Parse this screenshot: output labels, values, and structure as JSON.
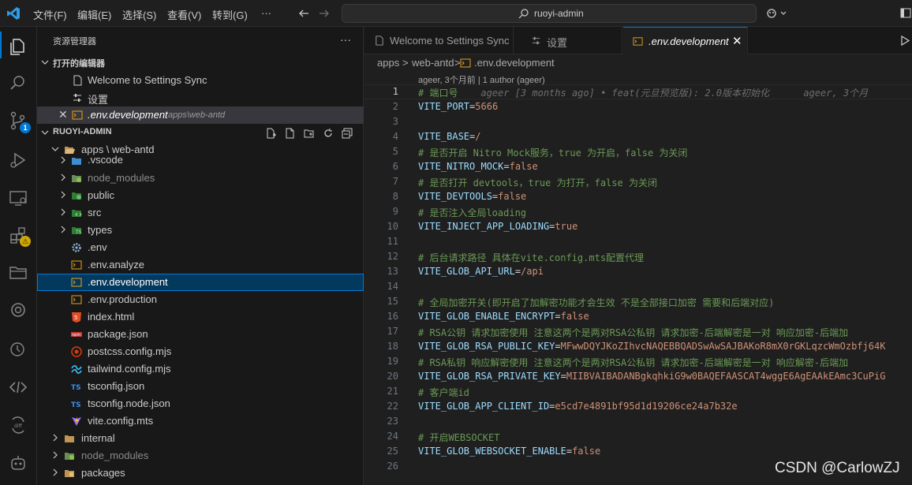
{
  "menu": [
    "文件(F)",
    "编辑(E)",
    "选择(S)",
    "查看(V)",
    "转到(G)",
    "···"
  ],
  "command_center": {
    "label": "ruoyi-admin"
  },
  "activity_badges": {
    "scm": "1",
    "extensions": "⚠"
  },
  "sidebar": {
    "title": "资源管理器",
    "open_editors_header": "打开的编辑器",
    "open_editors": [
      {
        "name": "Welcome to Settings Sync",
        "path": ""
      },
      {
        "name": "设置",
        "path": ""
      },
      {
        "name": ".env.development",
        "path": "apps\\web-antd"
      }
    ],
    "workspace_header": "RUOYI-ADMIN",
    "tree": [
      {
        "name": "apps \\ web-antd",
        "kind": "folder-open",
        "depth": 1
      },
      {
        "name": ".vscode",
        "kind": "folder",
        "depth": 2
      },
      {
        "name": "node_modules",
        "kind": "folder",
        "depth": 2,
        "dim": true
      },
      {
        "name": "public",
        "kind": "folder",
        "depth": 2
      },
      {
        "name": "src",
        "kind": "folder",
        "depth": 2
      },
      {
        "name": "types",
        "kind": "folder",
        "depth": 2
      },
      {
        "name": ".env",
        "kind": "gear",
        "depth": 2
      },
      {
        "name": ".env.analyze",
        "kind": "env",
        "depth": 2
      },
      {
        "name": ".env.development",
        "kind": "env",
        "depth": 2,
        "selected": true
      },
      {
        "name": ".env.production",
        "kind": "env",
        "depth": 2
      },
      {
        "name": "index.html",
        "kind": "html",
        "depth": 2
      },
      {
        "name": "package.json",
        "kind": "npm",
        "depth": 2
      },
      {
        "name": "postcss.config.mjs",
        "kind": "postcss",
        "depth": 2
      },
      {
        "name": "tailwind.config.mjs",
        "kind": "tailwind",
        "depth": 2
      },
      {
        "name": "tsconfig.json",
        "kind": "ts",
        "depth": 2
      },
      {
        "name": "tsconfig.node.json",
        "kind": "ts",
        "depth": 2
      },
      {
        "name": "vite.config.mts",
        "kind": "vite",
        "depth": 2
      },
      {
        "name": "internal",
        "kind": "folder",
        "depth": 1
      },
      {
        "name": "node_modules",
        "kind": "folder",
        "depth": 1,
        "dim": true
      },
      {
        "name": "packages",
        "kind": "folder",
        "depth": 1
      }
    ]
  },
  "tabs": [
    {
      "label": "Welcome to Settings Sync"
    },
    {
      "label": "设置"
    },
    {
      "label": ".env.development",
      "active": true
    }
  ],
  "breadcrumbs": [
    "apps",
    ">",
    "web-antd",
    ">",
    ".env.development"
  ],
  "blame": "ageer, 3个月前 | 1 author (ageer)",
  "ghost_blame": "ageer [3 months ago] • feat(元旦预览版): 2.0版本初始化      ageer, 3个月",
  "code": [
    {
      "n": "1",
      "c": "# 端口号"
    },
    {
      "n": "2",
      "k": "VITE_PORT",
      "v": "5666"
    },
    {
      "n": "3"
    },
    {
      "n": "4",
      "k": "VITE_BASE",
      "v": "/"
    },
    {
      "n": "5",
      "c": "# 是否开启 Nitro Mock服务，true 为开启，false 为关闭"
    },
    {
      "n": "6",
      "k": "VITE_NITRO_MOCK",
      "v": "false"
    },
    {
      "n": "7",
      "c": "# 是否打开 devtools，true 为打开，false 为关闭"
    },
    {
      "n": "8",
      "k": "VITE_DEVTOOLS",
      "v": "false"
    },
    {
      "n": "9",
      "c": "# 是否注入全局loading"
    },
    {
      "n": "10",
      "k": "VITE_INJECT_APP_LOADING",
      "v": "true"
    },
    {
      "n": "11"
    },
    {
      "n": "12",
      "c": "# 后台请求路径 具体在vite.config.mts配置代理"
    },
    {
      "n": "13",
      "k": "VITE_GLOB_API_URL",
      "v": "/api"
    },
    {
      "n": "14"
    },
    {
      "n": "15",
      "c": "# 全局加密开关(即开启了加解密功能才会生效 不是全部接口加密 需要和后端对应)"
    },
    {
      "n": "16",
      "k": "VITE_GLOB_ENABLE_ENCRYPT",
      "v": "false"
    },
    {
      "n": "17",
      "c": "# RSA公钥 请求加密使用 注意这两个是两对RSA公私钥 请求加密-后端解密是一对 响应加密-后端加"
    },
    {
      "n": "18",
      "k": "VITE_GLOB_RSA_PUBLIC_KEY",
      "v": "MFwwDQYJKoZIhvcNAQEBBQADSwAwSAJBAKoR8mX0rGKLqzcWmOzbfj64K"
    },
    {
      "n": "19",
      "c": "# RSA私钥 响应解密使用 注意这两个是两对RSA公私钥 请求加密-后端解密是一对 响应解密-后端加"
    },
    {
      "n": "20",
      "k": "VITE_GLOB_RSA_PRIVATE_KEY",
      "v": "MIIBVAIBADANBgkqhkiG9w0BAQEFAASCAT4wggE6AgEAAkEAmc3CuPiG"
    },
    {
      "n": "21",
      "c": "# 客户端id"
    },
    {
      "n": "22",
      "k": "VITE_GLOB_APP_CLIENT_ID",
      "v": "e5cd7e4891bf95d1d19206ce24a7b32e"
    },
    {
      "n": "23"
    },
    {
      "n": "24",
      "c": "# 开启WEBSOCKET"
    },
    {
      "n": "25",
      "k": "VITE_GLOB_WEBSOCKET_ENABLE",
      "v": "false"
    },
    {
      "n": "26"
    }
  ],
  "watermark": "CSDN @CarlowZJ",
  "colors": {
    "accent": "#0078d4",
    "comment": "#6a9955",
    "key": "#9cdcfe",
    "value": "#ce9178",
    "selection": "#04395e"
  }
}
